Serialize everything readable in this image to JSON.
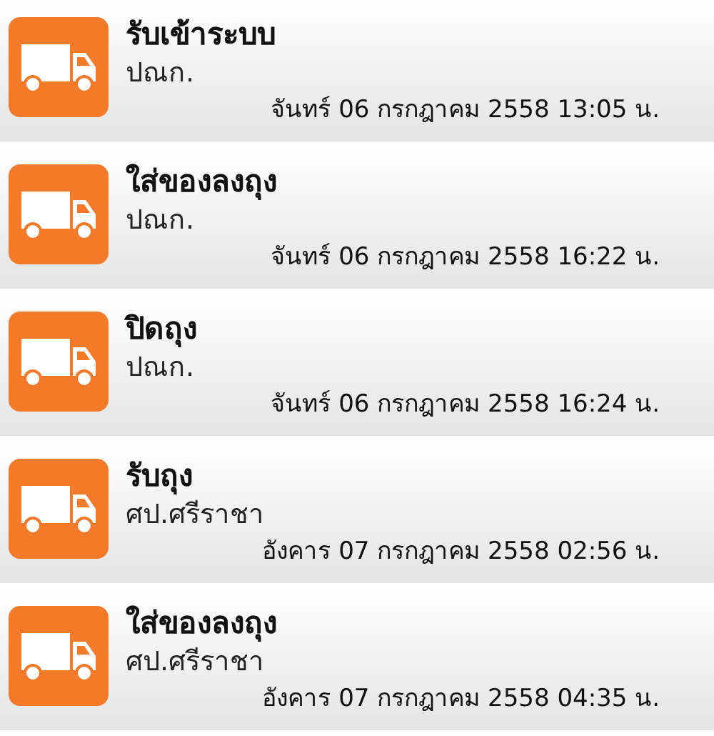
{
  "notifications": [
    {
      "title": "รับเข้าระบบ",
      "location": "ปณก.",
      "time": "จันทร์ 06 กรกฎาคม 2558 13:05 น."
    },
    {
      "title": "ใส่ของลงถุง",
      "location": "ปณก.",
      "time": "จันทร์ 06 กรกฎาคม 2558 16:22 น."
    },
    {
      "title": "ปิดถุง",
      "location": "ปณก.",
      "time": "จันทร์ 06 กรกฎาคม 2558 16:24 น."
    },
    {
      "title": "รับถุง",
      "location": "ศป.ศรีราชา",
      "time": "อังคาร 07 กรกฎาคม 2558 02:56 น."
    },
    {
      "title": "ใส่ของลงถุง",
      "location": "ศป.ศรีราชา",
      "time": "อังคาร 07 กรกฎาคม 2558 04:35 น."
    }
  ]
}
